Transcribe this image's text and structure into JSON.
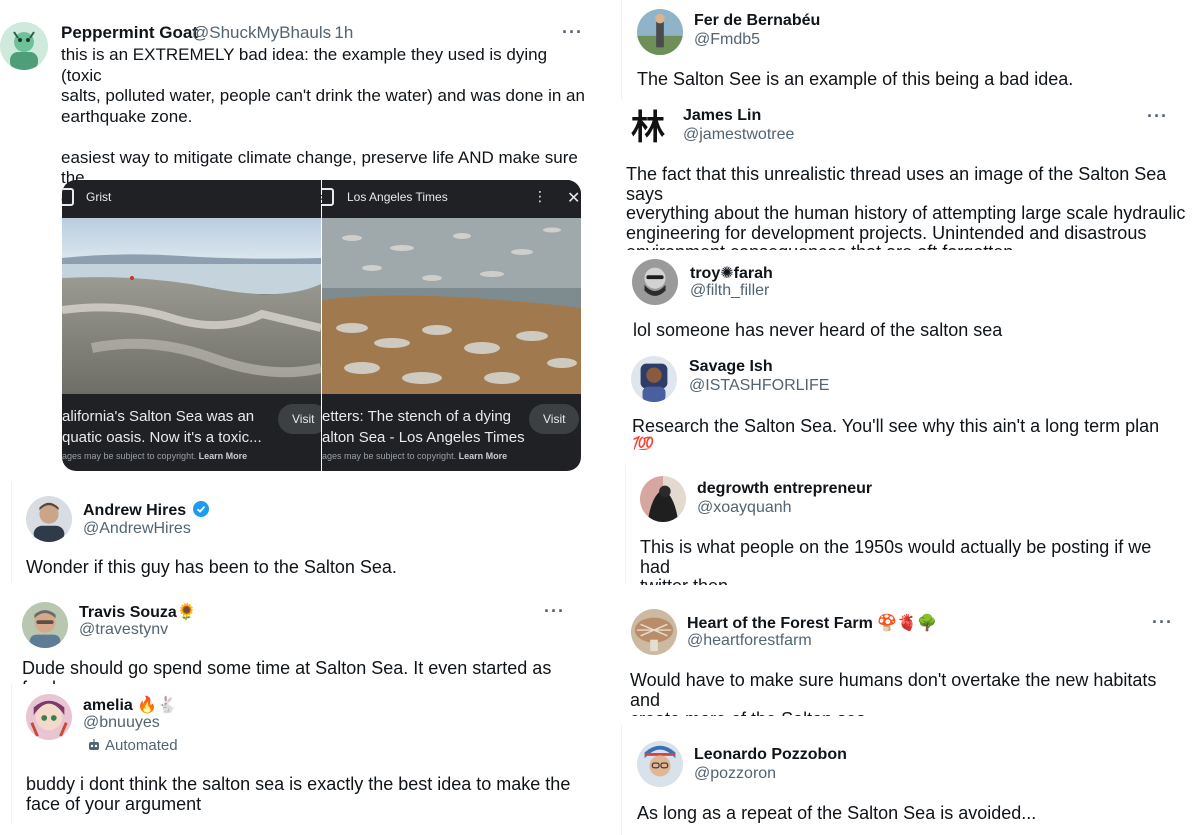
{
  "tweets": {
    "peppermint": {
      "name": "Peppermint Goat",
      "handle": "@ShuckMyBhauls",
      "time": "· 1h",
      "text": "this is an EXTREMELY bad idea: the example they used is dying (toxic\nsalts, polluted water, people can't drink the water) and was done in an\nearthquake zone.\n\neasiest way to mitigate climate change, preserve life AND make sure the\neconomy still exists? stop using fossil fuels 👍",
      "images": [
        {
          "source": "Grist",
          "caption": "alifornia's Salton Sea was an\nquatic oasis. Now it's a toxic...",
          "visit": "Visit",
          "copyright": "ages may be subject to copyright.",
          "learn_more": "Learn More"
        },
        {
          "source": "Los Angeles Times",
          "caption": "etters: The stench of a dying\nalton Sea - Los Angeles Times",
          "visit": "Visit",
          "copyright": "ages may be subject to copyright.",
          "learn_more": "Learn More"
        }
      ]
    },
    "andrew": {
      "name": "Andrew Hires",
      "handle": "@AndrewHires",
      "text": "Wonder if this guy has been to the Salton Sea."
    },
    "travis": {
      "name": "Travis Souza🌻",
      "handle": "@travestynv",
      "text": "Dude should go spend some time at Salton Sea. It even started as fresh"
    },
    "amelia": {
      "name": "amelia 🔥🐇",
      "handle": "@bnuuyes",
      "automated": "Automated",
      "text": "buddy i dont think the salton sea is exactly the best idea to make the\nface of your argument"
    },
    "fer": {
      "name": "Fer de Bernabéu",
      "handle": "@Fmdb5",
      "text": "The Salton See is an example of this being a bad idea."
    },
    "james": {
      "name": "James Lin",
      "handle": "@jamestwotree",
      "avatar_glyph": "林",
      "text": "The fact that this unrealistic thread uses an image of the Salton Sea says\neverything about the human history of attempting large scale hydraulic\nengineering for development projects. Unintended and disastrous\nenvironment consequences that are oft forgotten."
    },
    "troy": {
      "name": "troy✺farah",
      "handle": "@filth_filler",
      "text": "lol someone has never heard of the salton sea"
    },
    "savage": {
      "name": "Savage Ish",
      "handle": "@ISTASHFORLIFE",
      "text": "Research the Salton Sea. You'll see why this ain't a long term plan 💯"
    },
    "degrowth": {
      "name": "degrowth entrepreneur",
      "handle": "@xoayquanh",
      "text": "This is what people on the 1950s would actually be posting if we had\ntwitter then"
    },
    "heart": {
      "name": "Heart of the Forest Farm 🍄🫀🌳",
      "handle": "@heartforestfarm",
      "text": "Would have to make sure humans don't overtake the new habitats and\ncreate more of the Salton sea"
    },
    "leonardo": {
      "name": "Leonardo Pozzobon",
      "handle": "@pozzoron",
      "text": "As long as a repeat of the Salton Sea is avoided..."
    }
  },
  "more_label": "···",
  "colors": {
    "text": "#0f1419",
    "secondary": "#536471",
    "verified": "#1d9bf0",
    "divider": "#eff3f4"
  },
  "icons": {
    "verified": "verified-badge-icon",
    "more": "more-options-icon",
    "robot": "robot-icon"
  }
}
